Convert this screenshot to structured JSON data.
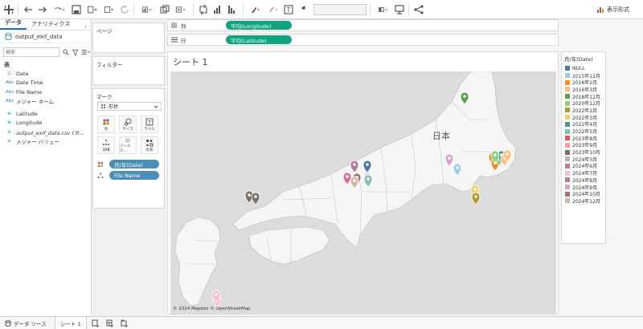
{
  "toolbar": {
    "show_me_label": "表示形式"
  },
  "data_panel": {
    "tab_data": "データ",
    "tab_analytics": "アナリティクス",
    "collapse_glyph": "‹",
    "datasource_name": "output_exif_data",
    "search_placeholder": "検索",
    "table_label": "表",
    "fields": [
      {
        "type": "date",
        "type_glyph": "⊡",
        "name": "Date"
      },
      {
        "type": "text",
        "type_glyph": "Abc",
        "name": "Date Time"
      },
      {
        "type": "text",
        "type_glyph": "Abc",
        "name": "File Name"
      },
      {
        "type": "text",
        "type_glyph": "Abc",
        "name": "メジャー ネーム"
      },
      {
        "type": "geo",
        "type_glyph": "⊕",
        "name": "Latitude"
      },
      {
        "type": "geo",
        "type_glyph": "⊕",
        "name": "Longitude"
      },
      {
        "type": "measure",
        "type_glyph": "≡",
        "name": "output_exif_data.csv (カ..."
      },
      {
        "type": "measure",
        "type_glyph": "≡",
        "name": "メジャー バリュー"
      }
    ]
  },
  "shelves": {
    "pages": "ページ",
    "filters": "フィルター",
    "marks": "マーク",
    "marks_type": "形状",
    "mark_buttons": [
      "色",
      "サイズ",
      "ラベル",
      "詳細",
      "ツールヒ...",
      "形状"
    ],
    "mark_pills": [
      "月/年(Date)",
      "File Name"
    ],
    "columns_label": "列",
    "columns_pill": "平均(Longitude)",
    "rows_label": "行",
    "rows_pill": "平均(Latitude)"
  },
  "sheet": {
    "title": "シート 1",
    "map_country_label": "日本",
    "attribution": "© 2024 Mapbox © OpenStreetMap"
  },
  "legend": {
    "title": "月/年(Date)",
    "items": [
      {
        "label": "NULL",
        "color": "#4e79a7"
      },
      {
        "label": "2015年12月",
        "color": "#a0cbe8"
      },
      {
        "label": "2016年2月",
        "color": "#f28e2b"
      },
      {
        "label": "2016年3月",
        "color": "#ffbe7d"
      },
      {
        "label": "2018年12月",
        "color": "#59a14f"
      },
      {
        "label": "2020年12月",
        "color": "#8cd17d"
      },
      {
        "label": "2022年2月",
        "color": "#b6992d"
      },
      {
        "label": "2022年3月",
        "color": "#f1ce63"
      },
      {
        "label": "2022年4月",
        "color": "#499894"
      },
      {
        "label": "2022年5月",
        "color": "#86bcb6"
      },
      {
        "label": "2023年8月",
        "color": "#e15759"
      },
      {
        "label": "2023年9月",
        "color": "#ff9d9a"
      },
      {
        "label": "2023年10月",
        "color": "#79706e"
      },
      {
        "label": "2024年3月",
        "color": "#bab0ac"
      },
      {
        "label": "2024年6月",
        "color": "#d37295"
      },
      {
        "label": "2024年7月",
        "color": "#fabfd2"
      },
      {
        "label": "2024年8月",
        "color": "#b07aa1"
      },
      {
        "label": "2024年9月",
        "color": "#d4a6c8"
      },
      {
        "label": "2024年10月",
        "color": "#9d7660"
      },
      {
        "label": "2024年12月",
        "color": "#d7b5a6"
      }
    ]
  },
  "bottom_tabs": {
    "datasource": "データ ソース",
    "sheet": "シート 1"
  }
}
